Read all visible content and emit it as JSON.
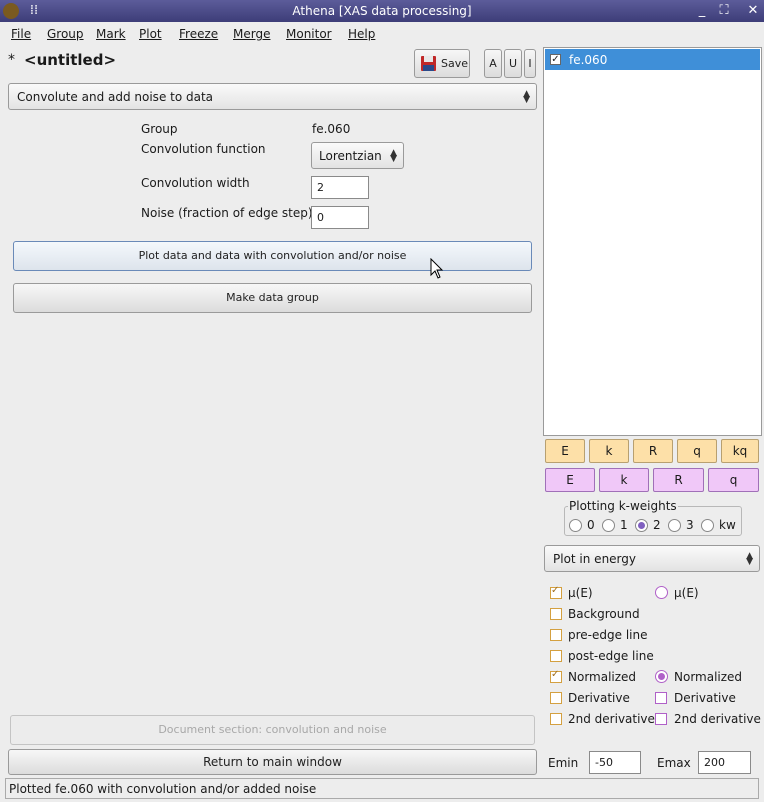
{
  "window": {
    "title": "Athena [XAS data processing]"
  },
  "menu": [
    "File",
    "Group",
    "Mark",
    "Plot",
    "Freeze",
    "Merge",
    "Monitor",
    "Help"
  ],
  "project": {
    "modified_mark": "*",
    "name": "<untitled>"
  },
  "toolbar": {
    "save_label": "Save",
    "a_label": "A",
    "u_label": "U",
    "i_label": "I"
  },
  "tool_selector": {
    "value": "Convolute and add noise to data"
  },
  "form": {
    "group_label": "Group",
    "group_value": "fe.060",
    "conv_function_label": "Convolution function",
    "conv_function_value": "Lorentzian",
    "conv_width_label": "Convolution width",
    "conv_width_value": "2",
    "noise_label": "Noise (fraction of edge step)",
    "noise_value": "0"
  },
  "buttons": {
    "plot": "Plot data and data with convolution and/or noise",
    "make_group": "Make data group",
    "document": "Document section: convolution and noise",
    "return": "Return to main window"
  },
  "status": "Plotted fe.060 with convolution and/or added noise",
  "group_list": [
    {
      "name": "fe.060",
      "checked": true,
      "selected": true
    }
  ],
  "plot_buttons": {
    "row1": [
      "E",
      "k",
      "R",
      "q",
      "kq"
    ],
    "row2": [
      "E",
      "k",
      "R",
      "q"
    ]
  },
  "kweights": {
    "label": "Plotting k-weights",
    "options": [
      "0",
      "1",
      "2",
      "3",
      "kw"
    ],
    "selected": "2"
  },
  "plot_space": {
    "value": "Plot in energy"
  },
  "energy_options": {
    "left": [
      {
        "label": "μ(E)",
        "checked": true
      },
      {
        "label": "Background",
        "checked": false
      },
      {
        "label": "pre-edge line",
        "checked": false
      },
      {
        "label": "post-edge line",
        "checked": false
      },
      {
        "label": "Normalized",
        "checked": true
      },
      {
        "label": "Derivative",
        "checked": false
      },
      {
        "label": "2nd derivative",
        "checked": false
      }
    ],
    "right": [
      {
        "label": "μ(E)",
        "type": "radio",
        "checked": false
      },
      {
        "label": "Normalized",
        "type": "radio",
        "checked": true
      },
      {
        "label": "Derivative",
        "type": "check",
        "checked": false
      },
      {
        "label": "2nd derivative",
        "type": "check",
        "checked": false
      }
    ]
  },
  "range": {
    "emin_label": "Emin",
    "emin_value": "-50",
    "emax_label": "Emax",
    "emax_value": "200"
  },
  "colors": {
    "titlebar": "#4a4a88",
    "selection": "#3f8fd8",
    "plot_orange": "#fde0a8",
    "plot_purple": "#f0c8f8"
  }
}
